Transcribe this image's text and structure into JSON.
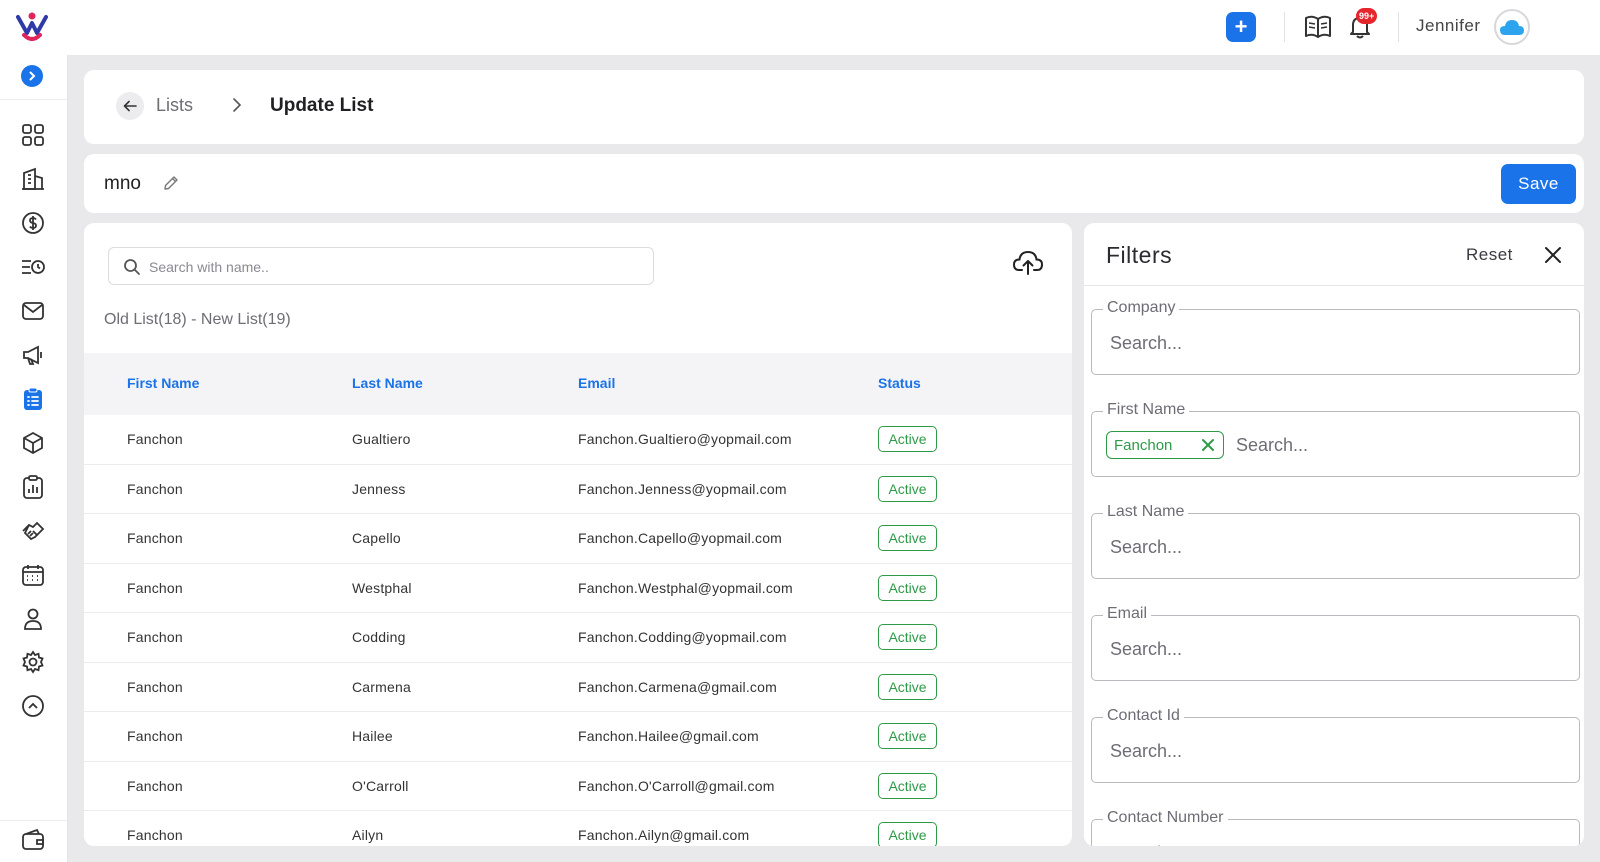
{
  "topbar": {
    "add_label": "+",
    "notifications_badge": "99+",
    "user_name": "Jennifer"
  },
  "sidebar": {
    "items": [
      "dashboard-icon",
      "building-icon",
      "dollar-icon",
      "list-clock-icon",
      "mail-icon",
      "megaphone-icon",
      "clipboard-list-icon",
      "box-icon",
      "report-icon",
      "handshake-icon",
      "calendar-icon",
      "user-icon",
      "gear-icon",
      "chevron-up-circle-icon"
    ],
    "active_item": "clipboard-list-icon",
    "footer_item": "wallet-icon"
  },
  "breadcrumb": {
    "parent": "Lists",
    "current": "Update List"
  },
  "list_name": "mno",
  "save_label": "Save",
  "table": {
    "search_placeholder": "Search with name..",
    "summary": "Old List(18) - New List(19)",
    "columns": [
      "First Name",
      "Last Name",
      "Email",
      "Status"
    ],
    "rows": [
      {
        "first": "Fanchon",
        "last": "Gualtiero",
        "email": "Fanchon.Gualtiero@yopmail.com",
        "status": "Active"
      },
      {
        "first": "Fanchon",
        "last": "Jenness",
        "email": "Fanchon.Jenness@yopmail.com",
        "status": "Active"
      },
      {
        "first": "Fanchon",
        "last": "Capello",
        "email": "Fanchon.Capello@yopmail.com",
        "status": "Active"
      },
      {
        "first": "Fanchon",
        "last": "Westphal",
        "email": "Fanchon.Westphal@yopmail.com",
        "status": "Active"
      },
      {
        "first": "Fanchon",
        "last": "Codding",
        "email": "Fanchon.Codding@yopmail.com",
        "status": "Active"
      },
      {
        "first": "Fanchon",
        "last": "Carmena",
        "email": "Fanchon.Carmena@gmail.com",
        "status": "Active"
      },
      {
        "first": "Fanchon",
        "last": "Hailee",
        "email": "Fanchon.Hailee@gmail.com",
        "status": "Active"
      },
      {
        "first": "Fanchon",
        "last": "O'Carroll",
        "email": "Fanchon.O'Carroll@gmail.com",
        "status": "Active"
      },
      {
        "first": "Fanchon",
        "last": "Ailyn",
        "email": "Fanchon.Ailyn@gmail.com",
        "status": "Active"
      }
    ]
  },
  "filters": {
    "title": "Filters",
    "reset_label": "Reset",
    "fields": [
      {
        "label": "Company",
        "placeholder": "Search..."
      },
      {
        "label": "First Name",
        "placeholder": "Search...",
        "chip": "Fanchon"
      },
      {
        "label": "Last Name",
        "placeholder": "Search..."
      },
      {
        "label": "Email",
        "placeholder": "Search..."
      },
      {
        "label": "Contact Id",
        "placeholder": "Search..."
      },
      {
        "label": "Contact Number",
        "placeholder": "Search..."
      }
    ]
  },
  "colors": {
    "primary": "#1a73e8",
    "active_status": "#2e9a48",
    "badge": "#e5262d"
  }
}
